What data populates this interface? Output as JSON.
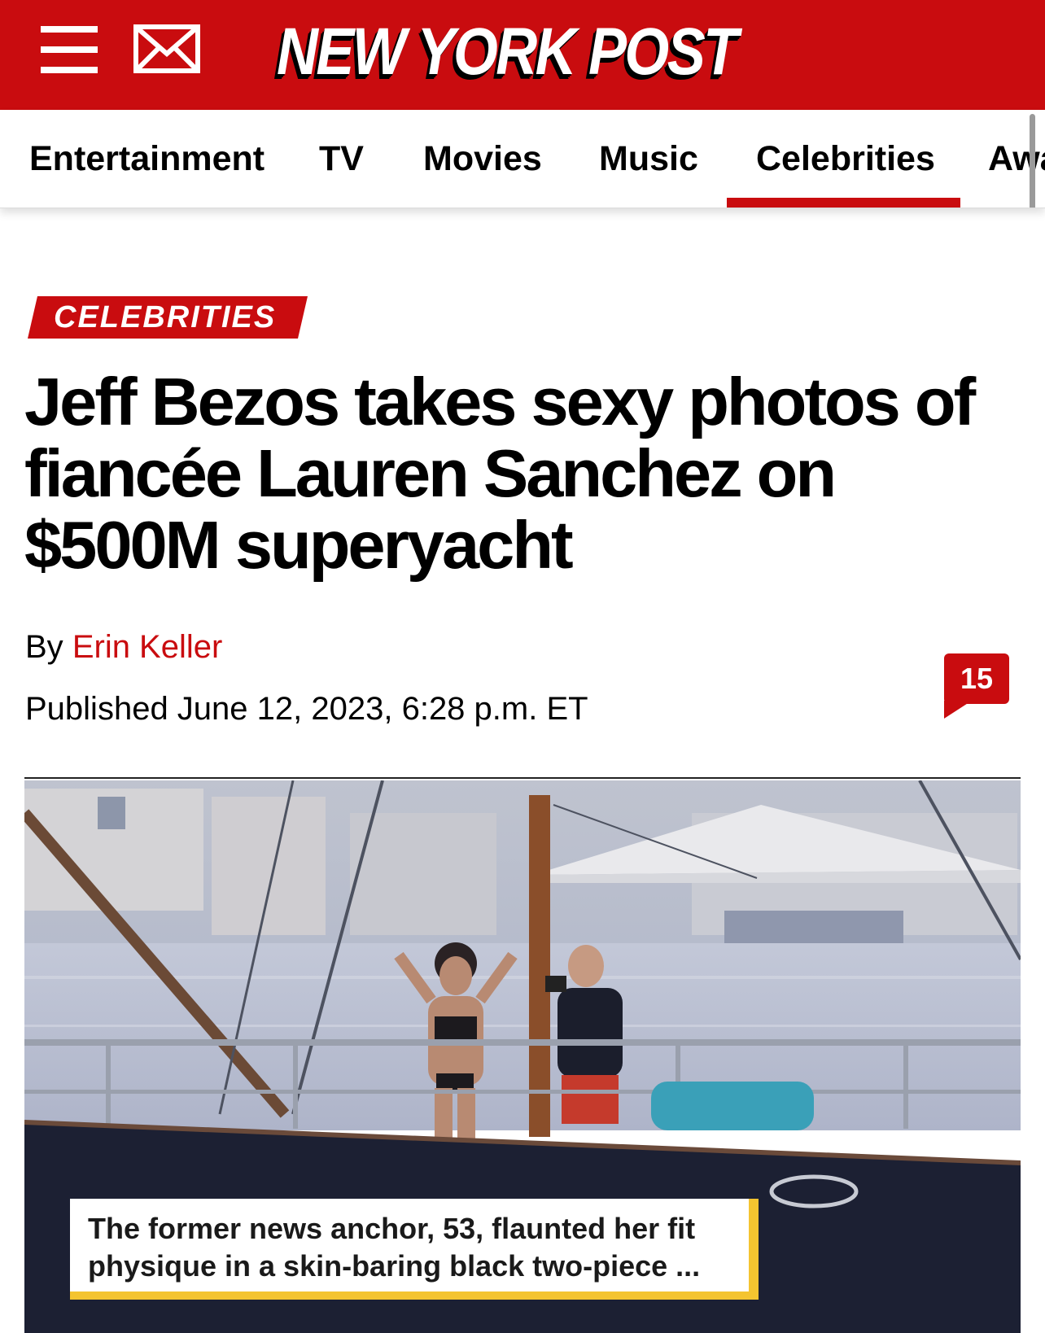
{
  "header": {
    "logo_text": "NEW YORK POST",
    "brand_color": "#c90c0f",
    "menu_icon": "hamburger-menu-icon",
    "mail_icon": "mail-envelope-icon"
  },
  "nav": {
    "tabs": [
      {
        "label": "Entertainment",
        "active": false
      },
      {
        "label": "TV",
        "active": false
      },
      {
        "label": "Movies",
        "active": false
      },
      {
        "label": "Music",
        "active": false
      },
      {
        "label": "Celebrities",
        "active": true
      },
      {
        "label": "Awa",
        "active": false
      }
    ],
    "active_underline_color": "#c90c0f"
  },
  "article": {
    "section_label": "CELEBRITIES",
    "headline": "Jeff Bezos takes sexy photos of fiancée Lauren Sanchez on $500M superyacht",
    "byline_prefix": "By",
    "author": "Erin Keller",
    "published": "Published June 12, 2023, 6:28 p.m. ET",
    "comment_count": "15",
    "comment_icon": "comment-bubble-icon"
  },
  "photo": {
    "caption": "The former news anchor, 53, flaunted her fit physique in a skin-baring black two-piece ...",
    "caption_accent_color": "#f4c430"
  }
}
